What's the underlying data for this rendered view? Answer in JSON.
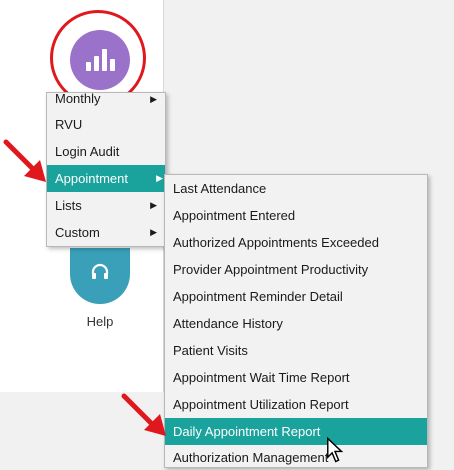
{
  "launcher": {
    "reports_icon": "bar-chart-icon",
    "help_icon": "headset-icon",
    "help_label": "Help"
  },
  "menu": {
    "items": [
      {
        "label": "Monthly",
        "has_submenu": true
      },
      {
        "label": "RVU",
        "has_submenu": false
      },
      {
        "label": "Login Audit",
        "has_submenu": false
      },
      {
        "label": "Appointment",
        "has_submenu": true,
        "selected": true
      },
      {
        "label": "Lists",
        "has_submenu": true
      },
      {
        "label": "Custom",
        "has_submenu": true
      }
    ],
    "submenu_arrow": "▶"
  },
  "submenu": {
    "items": [
      {
        "label": "Last Attendance"
      },
      {
        "label": "Appointment Entered"
      },
      {
        "label": "Authorized Appointments Exceeded"
      },
      {
        "label": "Provider Appointment Productivity"
      },
      {
        "label": "Appointment Reminder Detail"
      },
      {
        "label": "Attendance History"
      },
      {
        "label": "Patient Visits"
      },
      {
        "label": "Appointment Wait Time Report"
      },
      {
        "label": "Appointment Utilization Report"
      },
      {
        "label": "Daily Appointment Report",
        "highlighted": true
      },
      {
        "label": "Authorization Management"
      }
    ]
  },
  "colors": {
    "reports_button": "#9b72c9",
    "help_button": "#3a9fb8",
    "menu_selected": "#1aa39c",
    "annotation_red": "#e0181d"
  }
}
